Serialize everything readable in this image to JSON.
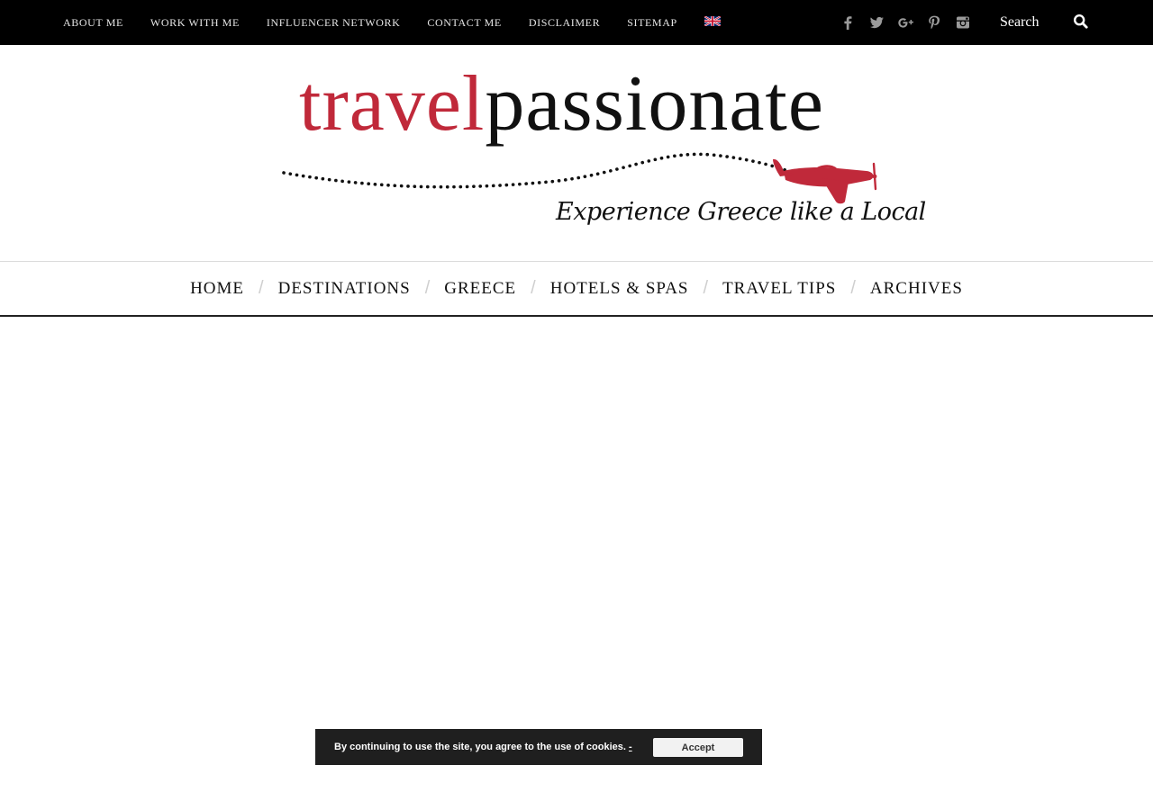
{
  "topbar": {
    "nav": [
      "ABOUT ME",
      "WORK WITH ME",
      "INFLUENCER NETWORK",
      "CONTACT ME",
      "DISCLAIMER",
      "SITEMAP"
    ],
    "social_icons": [
      "facebook-icon",
      "twitter-icon",
      "google-plus-icon",
      "pinterest-icon",
      "instagram-icon"
    ],
    "search_placeholder": "Search"
  },
  "logo": {
    "word_red": "travel",
    "word_black": "passionate",
    "tagline": "Experience Greece like a Local",
    "brand_red": "#c0293a"
  },
  "mainnav": [
    "HOME",
    "DESTINATIONS",
    "GREECE",
    "HOTELS & SPAS",
    "TRAVEL TIPS",
    "ARCHIVES"
  ],
  "cookie": {
    "text": "By continuing to use the site, you agree to the use of cookies.",
    "link": "-",
    "accept": "Accept"
  }
}
